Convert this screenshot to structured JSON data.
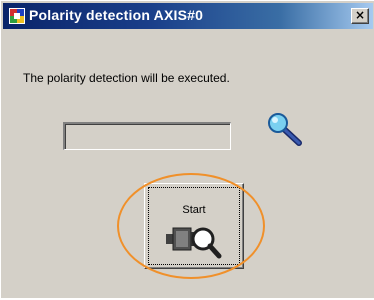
{
  "window": {
    "title": "Polarity detection AXIS#0",
    "app_icon": "ms-app-icon",
    "close_label": "×"
  },
  "content": {
    "message": "The polarity detection will be executed.",
    "result_value": "",
    "status_icon": "magnifier-icon",
    "start_button": {
      "label": "Start",
      "icon": "motor-magnifier-icon"
    }
  },
  "annotation": {
    "highlight_color": "#f0902a"
  },
  "colors": {
    "titlebar_start": "#0a246a",
    "titlebar_end": "#a6caf0",
    "window_bg": "#d4d0c8"
  }
}
